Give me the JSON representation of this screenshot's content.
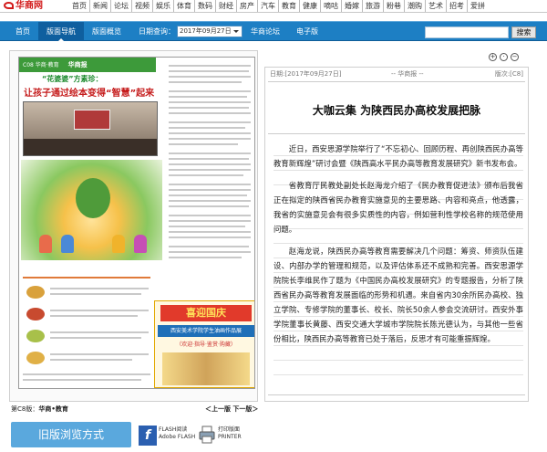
{
  "brand": {
    "logo_text": "华商网"
  },
  "top_nav": {
    "items": [
      "首页",
      "新闻",
      "论坛",
      "视频",
      "娱乐",
      "体育",
      "数码",
      "财经",
      "房产",
      "汽车",
      "教育",
      "健康",
      "嘀咕",
      "婚嫁",
      "旅游",
      "粉巷",
      "潮购",
      "艺术",
      "招考",
      "爱拼"
    ]
  },
  "blue_nav": {
    "items": [
      "首页",
      "版面导航",
      "版面概览"
    ],
    "date_label": "日期查询：",
    "date_value": "2017年09月27日",
    "items2": [
      "华商论坛",
      "电子版"
    ],
    "search_button": "搜索"
  },
  "newspaper": {
    "masthead": "C08 华商·教育",
    "masthead_logo": "华商报",
    "headline_small": "“花婆婆”方素珍：",
    "headline_big": "让孩子通过绘本变得“智慧”起来",
    "ad_title": "喜迎国庆",
    "ad_sub": "西安美术学院学生油画作品展",
    "ad_note": "（欢迎·指导·鉴赏·购藏）"
  },
  "article": {
    "meta_date": "日期:[2017年09月27日]",
    "meta_source": "-- 华商报 --",
    "meta_page": "版次:[C8]",
    "title": "大咖云集 为陕西民办高校发展把脉",
    "paragraphs": [
      "近日，西安思源学院举行了“不忘初心、回顾历程、再创陕西民办高等教育新辉煌”研讨会暨《陕西高水平民办高等教育发展研究》新书发布会。",
      "省教育厅民教处副处长赵海龙介绍了《民办教育促进法》颁布后我省正在拟定的陕西省民办教育实施意见的主要思路、内容和亮点，他透露，我省的实施意见会有很多实质性的内容，例如营利性学校名称的规范使用问题。",
      "赵海龙说，陕西民办高等教育需要解决几个问题：筹资、师资队伍建设、内部办学的管理和规范，以及评估体系还不成熟和完善。西安思源学院院长李维民作了题为《中国民办高校发展研究》的专题报告，分析了陕西省民办高等教育发展面临的形势和机遇。来自省内30余所民办高校、独立学院、专修学院的董事长、校长、院长50余人参会交流研讨。西安外事学院董事长黄藤、西安交通大学城市学院院长陈光德认为，与其他一些省份相比，陕西民办高等教育已处于落后，反思才有可能重振辉煌。"
    ]
  },
  "page_info": {
    "label_prefix": "第C8版：",
    "label_name": "华商•教育",
    "prev_next": "＜上一版 下一版＞"
  },
  "bottom_bar": {
    "old_button": "旧版浏览方式",
    "flash_label_1": "FLASH阅读",
    "flash_label_2": "Adobe FLASH",
    "print_label_1": "打印版面",
    "print_label_2": "PRINTER"
  },
  "icons": {
    "zoom_in": "zoom-in-icon",
    "zoom_out": "zoom-out-icon",
    "reset": "reset-icon"
  },
  "colors": {
    "nav_blue": "#1d7fc4",
    "brand_red": "#d21a1a",
    "old_button": "#5aa8dd"
  }
}
